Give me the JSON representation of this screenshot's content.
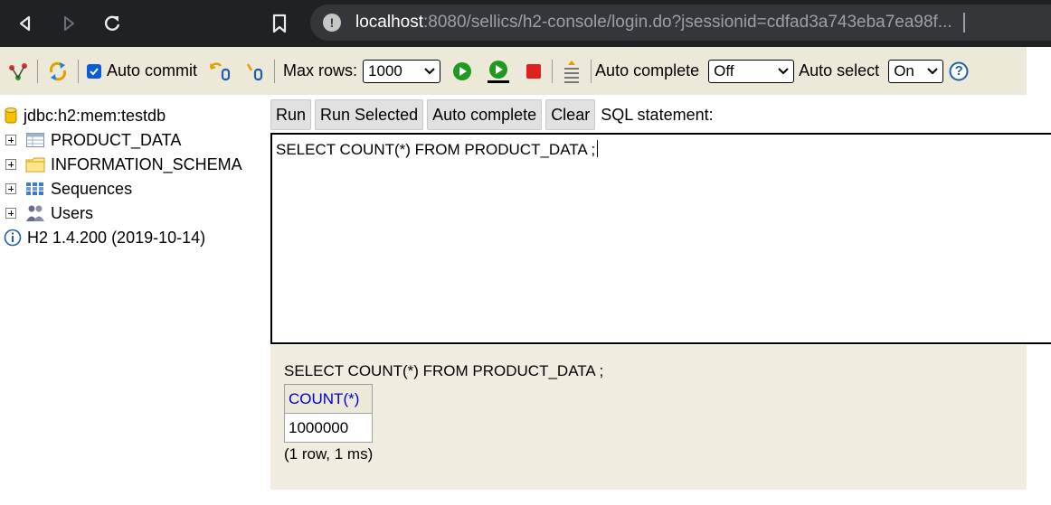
{
  "browser": {
    "url_host": "localhost",
    "url_rest": ":8080/sellics/h2-console/login.do?jsessionid=cdfad3a743eba7ea98f..."
  },
  "toolbar": {
    "auto_commit_label": "Auto commit",
    "auto_commit_checked": true,
    "max_rows_label": "Max rows:",
    "max_rows_value": "1000",
    "auto_complete_label": "Auto complete",
    "auto_complete_value": "Off",
    "auto_select_label": "Auto select",
    "auto_select_value": "On",
    "help_label": "?"
  },
  "tree": {
    "connection": "jdbc:h2:mem:testdb",
    "items": [
      {
        "label": "PRODUCT_DATA",
        "icon": "table-icon"
      },
      {
        "label": "INFORMATION_SCHEMA",
        "icon": "folder-icon"
      },
      {
        "label": "Sequences",
        "icon": "sequence-icon"
      },
      {
        "label": "Users",
        "icon": "users-icon"
      }
    ],
    "version": "H2 1.4.200 (2019-10-14)"
  },
  "actions": {
    "run": "Run",
    "run_selected": "Run Selected",
    "auto_complete": "Auto complete",
    "clear": "Clear",
    "sql_label": "SQL statement:"
  },
  "editor": {
    "text": "SELECT COUNT(*) FROM PRODUCT_DATA ;"
  },
  "result": {
    "statement": "SELECT COUNT(*) FROM PRODUCT_DATA ;",
    "columns": [
      "COUNT(*)"
    ],
    "rows": [
      [
        "1000000"
      ]
    ],
    "info": "(1 row, 1 ms)"
  },
  "colors": {
    "browser_bg": "#202124",
    "toolbar_bg": "#ece9d8",
    "result_bg": "#f0ede0",
    "header_link": "#0000cc"
  }
}
